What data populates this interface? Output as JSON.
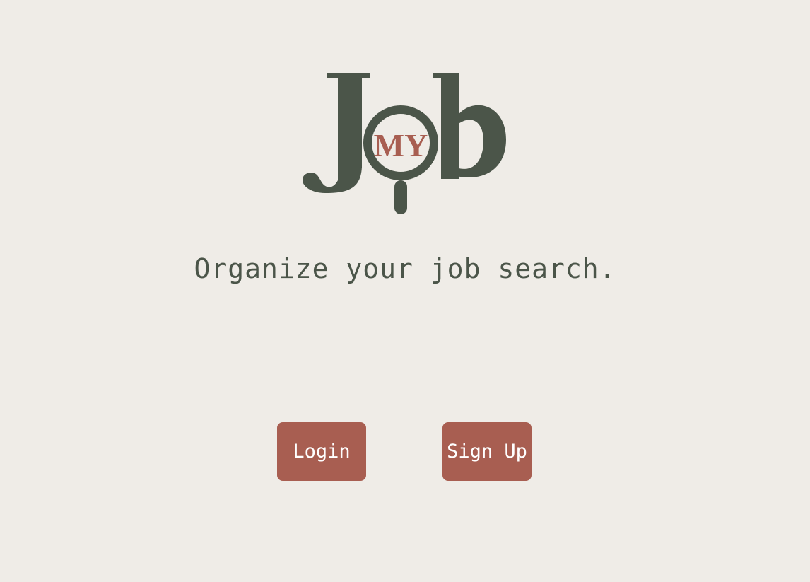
{
  "logo": {
    "badge_text": "MY",
    "name": "Job",
    "primary_color": "#4b5549",
    "accent_color": "#a85e51"
  },
  "hero": {
    "tagline": "Organize your job search."
  },
  "actions": {
    "login_label": "Login",
    "signup_label": "Sign Up"
  },
  "colors": {
    "background": "#efece7",
    "button": "#a85e51",
    "text": "#4b5549"
  }
}
